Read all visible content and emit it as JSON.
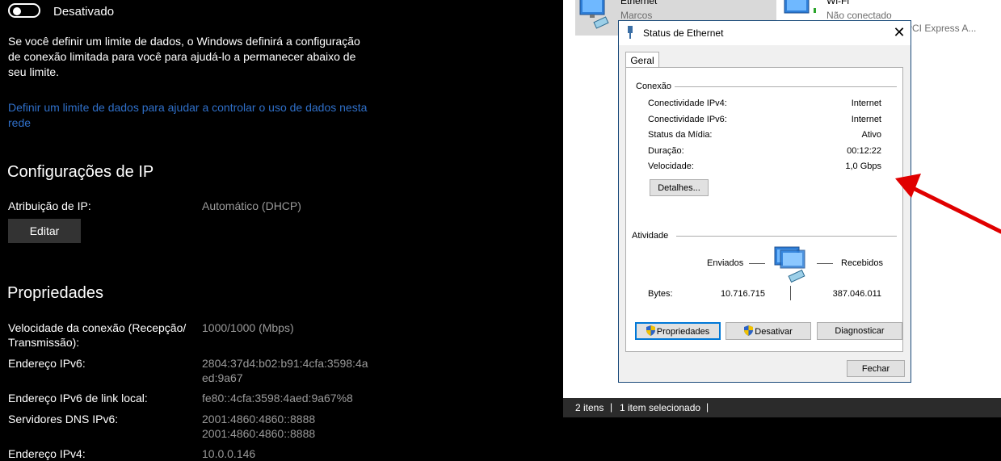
{
  "settings": {
    "toggle_label": "Desativado",
    "paragraph": "Se você definir um limite de dados, o Windows definirá a configuração de conexão limitada para você para ajudá-lo a permanecer abaixo de seu limite.",
    "link": "Definir um limite de dados para ajudar a controlar o uso de dados nesta rede",
    "ip_heading": "Configurações de IP",
    "ip_assign_label": "Atribuição de IP:",
    "ip_assign_value": "Automático (DHCP)",
    "edit_button": "Editar",
    "props_heading": "Propriedades",
    "props": [
      {
        "label": "Velocidade da conexão (Recepção/\nTransmissão):",
        "value": "1000/1000 (Mbps)"
      },
      {
        "label": "Endereço IPv6:",
        "value": "2804:37d4:b02:b91:4cfa:3598:4aed:9a67"
      },
      {
        "label": "Endereço IPv6 de link local:",
        "value": "fe80::4cfa:3598:4aed:9a67%8"
      },
      {
        "label": "Servidores DNS IPv6:",
        "value": "2001:4860:4860::8888\n2001:4860:4860::8888"
      },
      {
        "label": "Endereço IPv4:",
        "value": "10.0.0.146"
      }
    ]
  },
  "explorer": {
    "items": [
      {
        "name": "Ethernet",
        "sub": "Marcos"
      },
      {
        "name": "Wi-Fi",
        "sub": "Não conectado",
        "sub2": "PCI Express A..."
      }
    ],
    "status_count": "2 itens",
    "status_selected": "1 item selecionado"
  },
  "dialog": {
    "title": "Status de Ethernet",
    "close": "✕",
    "tab": "Geral",
    "group_connection": "Conexão",
    "rows": [
      {
        "label": "Conectividade IPv4:",
        "value": "Internet"
      },
      {
        "label": "Conectividade IPv6:",
        "value": "Internet"
      },
      {
        "label": "Status da Mídia:",
        "value": "Ativo"
      },
      {
        "label": "Duração:",
        "value": "00:12:22"
      },
      {
        "label": "Velocidade:",
        "value": "1,0 Gbps"
      }
    ],
    "details_button": "Detalhes...",
    "group_activity": "Atividade",
    "sent_label": "Enviados",
    "received_label": "Recebidos",
    "bytes_label": "Bytes:",
    "bytes_sent": "10.716.715",
    "bytes_received": "387.046.011",
    "properties_button": "Propriedades",
    "disable_button": "Desativar",
    "diagnose_button": "Diagnosticar",
    "close_button": "Fechar"
  },
  "colors": {
    "link": "#2f6fc8",
    "annotation_arrow": "#e00000"
  }
}
